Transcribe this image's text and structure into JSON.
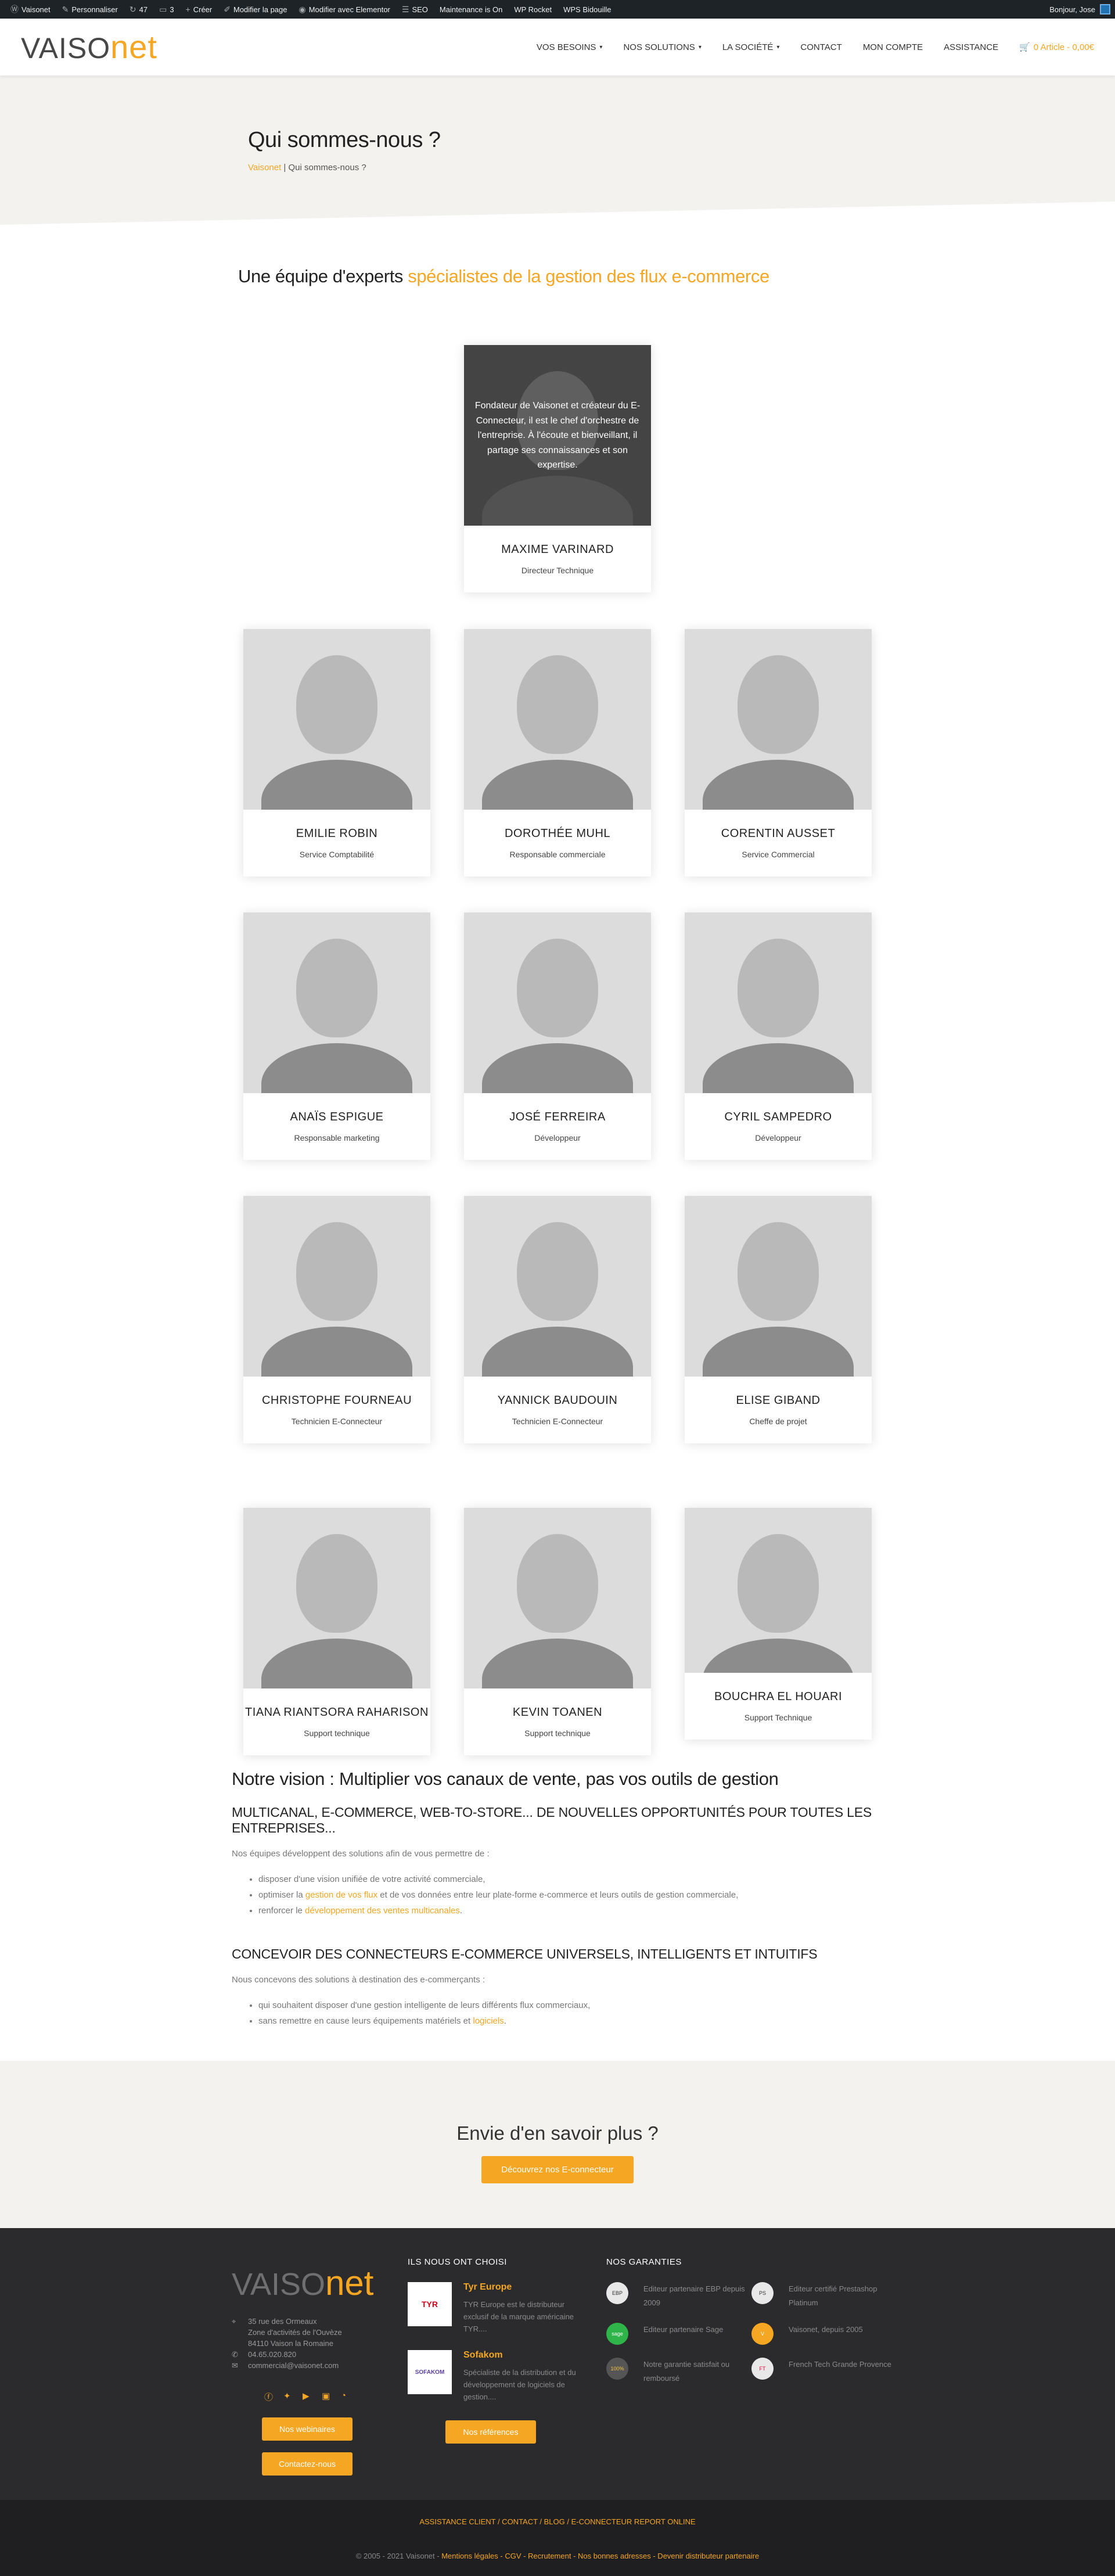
{
  "adminbar": {
    "items": [
      {
        "icon": "wordpress-icon",
        "label": "Vaisonet"
      },
      {
        "icon": "brush-icon",
        "label": "Personnaliser"
      },
      {
        "icon": "refresh-icon",
        "label": "47"
      },
      {
        "icon": "comment-icon",
        "label": "3"
      },
      {
        "icon": "plus-icon",
        "label": "Créer"
      },
      {
        "icon": "pencil-icon",
        "label": "Modifier la page"
      },
      {
        "icon": "elementor-icon",
        "label": "Modifier avec Elementor"
      },
      {
        "icon": "seo-icon",
        "label": "SEO"
      },
      {
        "icon": "",
        "label": "Maintenance is On"
      },
      {
        "icon": "",
        "label": "WP Rocket"
      },
      {
        "icon": "",
        "label": "WPS Bidouille"
      }
    ],
    "greeting": "Bonjour, Jose"
  },
  "header": {
    "logo_left": "VAISO",
    "logo_right": "net",
    "nav": [
      {
        "label": "VOS BESOINS",
        "caret": "▾"
      },
      {
        "label": "NOS SOLUTIONS",
        "caret": "▾"
      },
      {
        "label": "LA SOCIÉTÉ",
        "caret": "▾"
      },
      {
        "label": "CONTACT",
        "caret": ""
      },
      {
        "label": "MON COMPTE",
        "caret": ""
      },
      {
        "label": "ASSISTANCE",
        "caret": ""
      }
    ],
    "cart": "0 Article - 0,00€"
  },
  "hero": {
    "title": "Qui sommes-nous ?",
    "breadcrumb_home": "Vaisonet",
    "breadcrumb_sep": " | ",
    "breadcrumb_current": "Qui sommes-nous ?"
  },
  "team": {
    "title_plain": "Une équipe d'experts ",
    "title_accent": "spécialistes de la gestion des flux e-commerce",
    "featured": {
      "name": "MAXIME VARINARD",
      "role": "Directeur Technique",
      "bio": "Fondateur de Vaisonet et créateur du E-Connecteur, il est le chef d'orchestre de l'entreprise. À l'écoute et bienveillant, il partage ses connaissances et son expertise."
    },
    "members": [
      {
        "name": "EMILIE ROBIN",
        "role": "Service Comptabilité"
      },
      {
        "name": "DOROTHÉE MUHL",
        "role": "Responsable commerciale"
      },
      {
        "name": "CORENTIN AUSSET",
        "role": "Service Commercial"
      },
      {
        "name": "ANAÏS ESPIGUE",
        "role": "Responsable marketing"
      },
      {
        "name": "JOSÉ FERREIRA",
        "role": "Développeur"
      },
      {
        "name": "CYRIL SAMPEDRO",
        "role": "Développeur"
      },
      {
        "name": "CHRISTOPHE FOURNEAU",
        "role": "Technicien E-Connecteur"
      },
      {
        "name": "YANNICK BAUDOUIN",
        "role": "Technicien E-Connecteur"
      },
      {
        "name": "ELISE GIBAND",
        "role": "Cheffe de projet"
      },
      {
        "name": "TIANA RIANTSORA RAHARISON",
        "role": "Support technique"
      },
      {
        "name": "KEVIN TOANEN",
        "role": "Support technique"
      },
      {
        "name": "BOUCHRA EL HOUARI",
        "role": "Support Technique"
      }
    ]
  },
  "vision": {
    "title": "Notre vision : Multiplier vos canaux de vente, pas vos outils de gestion",
    "h3_1": "MULTICANAL, E-COMMERCE, WEB-TO-STORE... DE NOUVELLES OPPORTUNITÉS POUR TOUTES LES ENTREPRISES...",
    "p1": "Nos équipes développent des solutions afin de vous permettre de :",
    "li1": "disposer d'une vision unifiée de votre activité commerciale,",
    "li2_a": "optimiser la ",
    "li2_link": "gestion de vos flux",
    "li2_b": " et de vos données entre leur plate-forme e-commerce et leurs outils de gestion commerciale,",
    "li3_a": "renforcer le ",
    "li3_link": "développement des ventes multicanales",
    "li3_b": ".",
    "h3_2": "CONCEVOIR DES CONNECTEURS E-COMMERCE UNIVERSELS, INTELLIGENTS ET INTUITIFS",
    "p2": "Nous concevons des solutions à destination des e-commerçants :",
    "li4": "qui souhaitent disposer d'une gestion intelligente de leurs différents flux commerciaux,",
    "li5_a": "sans remettre en cause leurs équipements matériels et ",
    "li5_link": "logiciels",
    "li5_b": "."
  },
  "cta": {
    "title": "Envie d'en savoir plus ?",
    "button": "Découvrez nos E-connecteur"
  },
  "footer": {
    "logo_left": "VAISO",
    "logo_right": "net",
    "address1": "35 rue des Ormeaux",
    "address2": "Zone d'activités de l'Ouvèze",
    "address3": "84110 Vaison la Romaine",
    "phone": "04.65.020.820",
    "email": "commercial@vaisonet.com",
    "webinars_button": "Nos webinaires",
    "contact_button": "Contactez-nous",
    "refs_title": "ILS NOUS ONT CHOISI",
    "partner1_name": "Tyr Europe",
    "partner1_logo": "TYR",
    "partner1_desc": "TYR Europe est le distributeur exclusif de la marque américaine TYR....",
    "partner2_name": "Sofakom",
    "partner2_logo": "SOFAKOM",
    "partner2_desc": "Spécialiste de la distribution et du développement de logiciels de gestion....",
    "refs_button": "Nos références",
    "guarantees_title": "NOS GARANTIES",
    "guarantees": [
      {
        "icon": "ebp-icon",
        "badge": "EBP",
        "text": "Editeur partenaire EBP depuis 2009"
      },
      {
        "icon": "prestashop-icon",
        "badge": "PS",
        "text": "Editeur certifié Prestashop Platinum"
      },
      {
        "icon": "sage-icon",
        "badge": "sage",
        "text": "Editeur partenaire Sage"
      },
      {
        "icon": "vaisonet-badge-icon",
        "badge": "V",
        "text": "Vaisonet, depuis 2005"
      },
      {
        "icon": "satisfaction-icon",
        "badge": "100%",
        "text": "Notre garantie satisfait ou remboursé"
      },
      {
        "icon": "frenchtech-icon",
        "badge": "FT",
        "text": "French Tech Grande Provence"
      }
    ]
  },
  "subfooter": {
    "links": "ASSISTANCE CLIENT / CONTACT / BLOG / E-CONNECTEUR REPORT ONLINE",
    "copyright": "© 2005 - 2021 Vaisonet - ",
    "legal_links": "Mentions légales - CGV - Recrutement - Nos bonnes adresses - Devenir distributeur partenaire"
  },
  "colors": {
    "accent": "#f5a623",
    "footer_bg": "#2b2b2d",
    "hero_bg": "#f4f2ef"
  }
}
